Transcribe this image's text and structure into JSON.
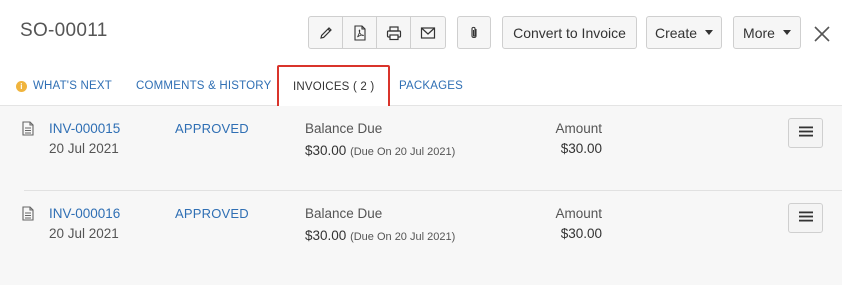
{
  "header": {
    "title": "SO-00011",
    "convert_label": "Convert to Invoice",
    "create_label": "Create",
    "more_label": "More"
  },
  "tabs": [
    {
      "label": "WHAT'S NEXT"
    },
    {
      "label": "COMMENTS & HISTORY"
    },
    {
      "label": "INVOICES ( 2 )"
    },
    {
      "label": "PACKAGES"
    }
  ],
  "invoices": [
    {
      "number": "INV-000015",
      "date": "20 Jul 2021",
      "status": "APPROVED",
      "balance_label": "Balance Due",
      "balance": "$30.00",
      "due_note": "(Due On 20 Jul 2021)",
      "amount_label": "Amount",
      "amount": "$30.00"
    },
    {
      "number": "INV-000016",
      "date": "20 Jul 2021",
      "status": "APPROVED",
      "balance_label": "Balance Due",
      "balance": "$30.00",
      "due_note": "(Due On 20 Jul 2021)",
      "amount_label": "Amount",
      "amount": "$30.00"
    }
  ]
}
